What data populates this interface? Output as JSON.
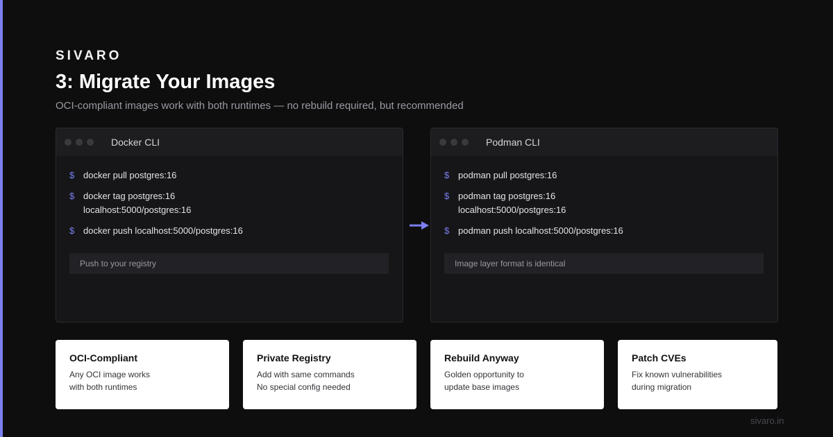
{
  "brand": "SIVARO",
  "title": "3: Migrate Your Images",
  "subtitle": "OCI-compliant images work with both runtimes — no rebuild required, but recommended",
  "accent_color": "#7b7ff0",
  "terminals": [
    {
      "title": "Docker CLI",
      "prompt": "$",
      "commands": [
        "docker pull postgres:16",
        "docker tag postgres:16 localhost:5000/postgres:16",
        "docker push localhost:5000/postgres:16"
      ],
      "note": "Push to your registry"
    },
    {
      "title": "Podman CLI",
      "prompt": "$",
      "commands": [
        "podman pull postgres:16",
        "podman tag postgres:16 localhost:5000/postgres:16",
        "podman push localhost:5000/postgres:16"
      ],
      "note": "Image layer format is identical"
    }
  ],
  "arrow_icon": "right-arrow-icon",
  "cards": [
    {
      "title": "OCI-Compliant",
      "lines": [
        "Any OCI image works",
        "with both runtimes"
      ]
    },
    {
      "title": "Private Registry",
      "lines": [
        "Add with same commands",
        "No special config needed"
      ]
    },
    {
      "title": "Rebuild Anyway",
      "lines": [
        "Golden opportunity to",
        "update base images"
      ]
    },
    {
      "title": "Patch CVEs",
      "lines": [
        "Fix known vulnerabilities",
        "during migration"
      ]
    }
  ],
  "footer": "sivaro.in"
}
